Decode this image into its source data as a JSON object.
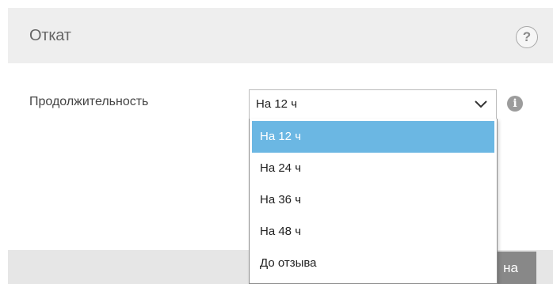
{
  "header": {
    "title": "Откат",
    "help_icon": "?"
  },
  "form": {
    "duration_label": "Продолжительность",
    "duration_value": "На 12 ч",
    "chevron_icon": "chevron-down-icon",
    "info_icon": "i"
  },
  "dropdown": {
    "options": [
      {
        "label": "На 12 ч",
        "selected": true
      },
      {
        "label": "На 24 ч",
        "selected": false
      },
      {
        "label": "На 36 ч",
        "selected": false
      },
      {
        "label": "На 48 ч",
        "selected": false
      },
      {
        "label": "До отзыва",
        "selected": false
      }
    ]
  },
  "footer": {
    "button_partial_label": "на"
  },
  "colors": {
    "header_bg": "#eeeeee",
    "selected_option_bg": "#6bb7e3",
    "footer_button_bg": "#888888"
  }
}
